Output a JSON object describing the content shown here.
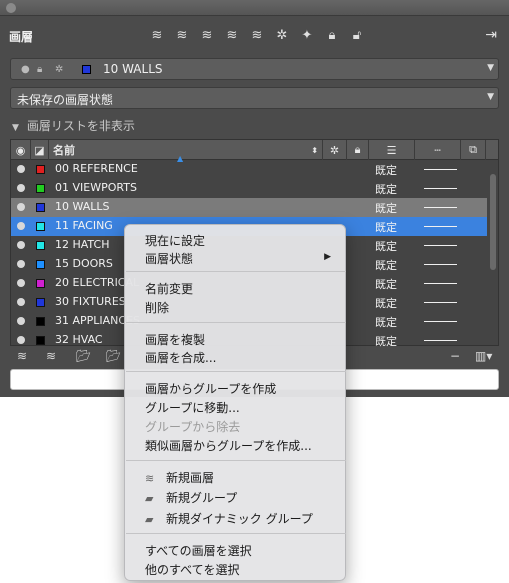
{
  "palette": {
    "title": "画層",
    "current_layer": "10 WALLS",
    "layer_state": "未保存の画層状態",
    "filter_toggle": "画層リストを非表示",
    "columns": {
      "name": "名前"
    },
    "rows": [
      {
        "name": "00 REFERENCE",
        "color": "#e02020",
        "mode": "既定",
        "state": "normal"
      },
      {
        "name": "01 VIEWPORTS",
        "color": "#22cc22",
        "mode": "既定",
        "state": "normal"
      },
      {
        "name": "10 WALLS",
        "color": "#2037d9",
        "mode": "既定",
        "state": "selected"
      },
      {
        "name": "11 FACING",
        "color": "#22e6e6",
        "mode": "既定",
        "state": "active"
      },
      {
        "name": "12 HATCH",
        "color": "#22e6e6",
        "mode": "既定",
        "state": "normal"
      },
      {
        "name": "15 DOORS",
        "color": "#1e90ff",
        "mode": "既定",
        "state": "normal"
      },
      {
        "name": "20 ELECTRICAL",
        "color": "#d020d0",
        "mode": "既定",
        "state": "normal"
      },
      {
        "name": "30 FIXTURES",
        "color": "#2037d9",
        "mode": "既定",
        "state": "normal"
      },
      {
        "name": "31 APPLIANCES",
        "color": "#000000",
        "mode": "既定",
        "state": "normal"
      },
      {
        "name": "32 HVAC",
        "color": "#000000",
        "mode": "既定",
        "state": "normal"
      }
    ],
    "bottom_icons": [
      "new-layer-icon",
      "new-layer-vp-icon",
      "new-group-icon",
      "new-dynamic-group-icon",
      "minus-icon",
      "column-options-icon"
    ]
  },
  "context_menu": {
    "items": {
      "set_current": "現在に設定",
      "layer_state": "画層状態",
      "rename": "名前変更",
      "delete": "削除",
      "duplicate": "画層を複製",
      "merge": "画層を合成...",
      "group_from_layers": "画層からグループを作成",
      "move_to_group": "グループに移動...",
      "remove_from_group": "グループから除去",
      "group_from_similar": "類似画層からグループを作成...",
      "new_layer": "新規画層",
      "new_group": "新規グループ",
      "new_dynamic_group": "新規ダイナミック グループ",
      "select_all": "すべての画層を選択",
      "select_others": "他のすべてを選択"
    }
  }
}
